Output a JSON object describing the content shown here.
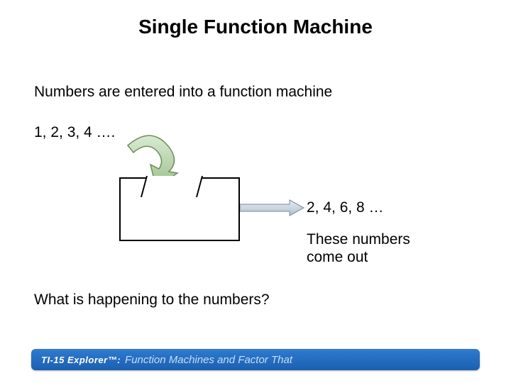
{
  "title": "Single Function Machine",
  "intro": "Numbers are entered into a function machine",
  "input_numbers": "1, 2, 3, 4 ….",
  "output_numbers": "2, 4, 6, 8 …",
  "output_caption_line1": "These numbers",
  "output_caption_line2": "come out",
  "question": "What is happening to the numbers?",
  "footer": {
    "logo": "TI-15 Explorer™:",
    "text": "Function Machines and Factor That"
  }
}
